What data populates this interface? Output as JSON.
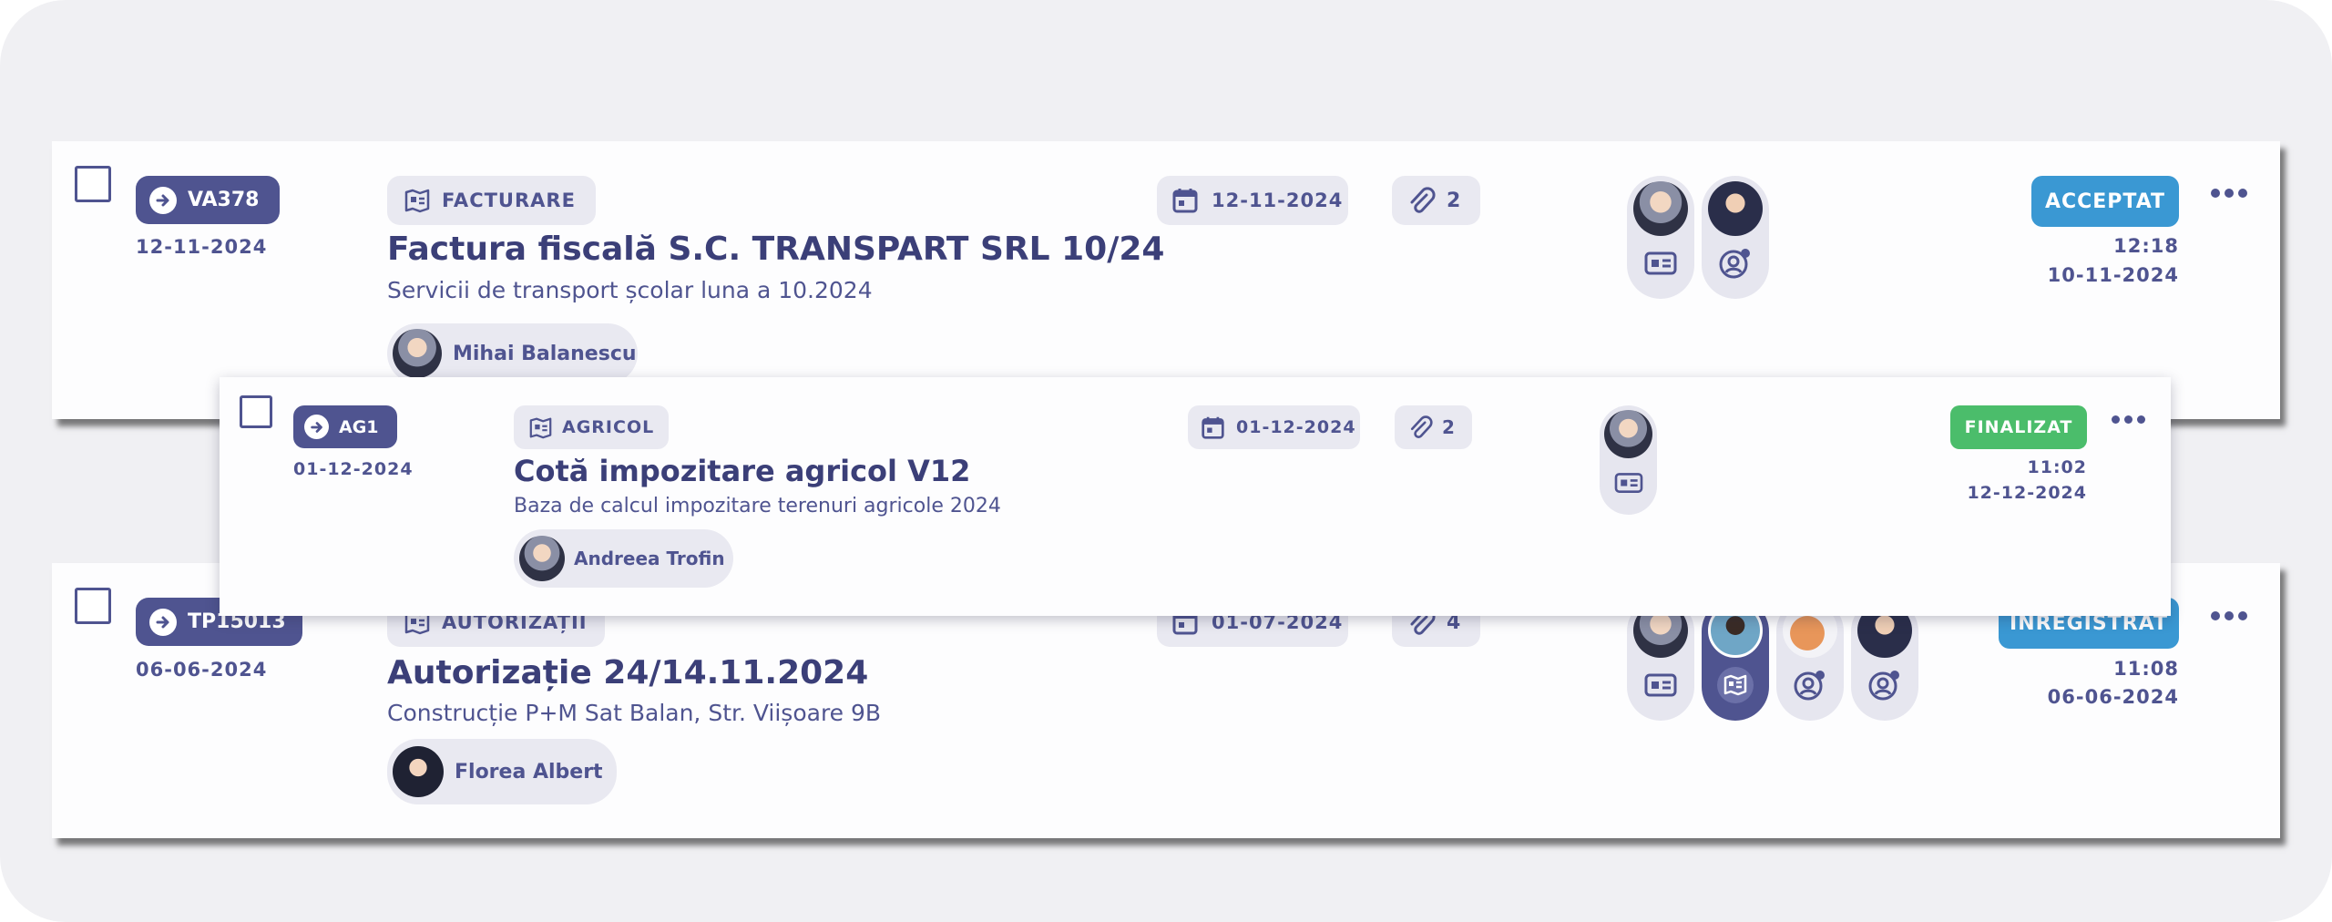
{
  "colors": {
    "primary": "#4f5490",
    "acceptat": "#3a98d3",
    "finalizat": "#4bbd6b",
    "inregistrat": "#3a98d3",
    "chip_bg": "#e9e9f1"
  },
  "documents": [
    {
      "ref": "VA378",
      "ref_date": "12-11-2024",
      "category": "FACTURARE",
      "category_icon": "map-icon",
      "title": "Factura fiscală S.C. TRANSPART SRL 10/24",
      "subtitle": "Servicii de transport școlar luna a 10.2024",
      "assignee": "Mihai Balanescu",
      "due_date": "12-11-2024",
      "attachments": "2",
      "status": "ACCEPTAT",
      "time": "12:18",
      "status_date": "10-11-2024",
      "avatar_roles": [
        "id-card-icon",
        "eye-user-icon"
      ]
    },
    {
      "ref": "AG1",
      "ref_date": "01-12-2024",
      "category": "AGRICOL",
      "category_icon": "map-icon",
      "title": "Cotă impozitare agricol V12",
      "subtitle": "Baza de calcul impozitare terenuri agricole 2024",
      "assignee": "Andreea Trofin",
      "due_date": "01-12-2024",
      "attachments": "2",
      "status": "FINALIZAT",
      "time": "11:02",
      "status_date": "12-12-2024",
      "avatar_roles": [
        "id-card-icon"
      ]
    },
    {
      "ref": "TP15013",
      "ref_date": "06-06-2024",
      "category": "AUTORIZAȚII",
      "category_icon": "map-icon",
      "title": "Autorizație 24/14.11.2024",
      "subtitle": "Construcție P+M Sat Balan, Str. Viișoare 9B",
      "assignee": "Florea Albert",
      "due_date": "01-07-2024",
      "attachments": "4",
      "status": "ÎNREGISTRAT",
      "time": "11:08",
      "status_date": "06-06-2024",
      "avatar_roles": [
        "id-card-icon",
        "map-icon",
        "eye-user-icon",
        "eye-user-icon"
      ]
    }
  ]
}
